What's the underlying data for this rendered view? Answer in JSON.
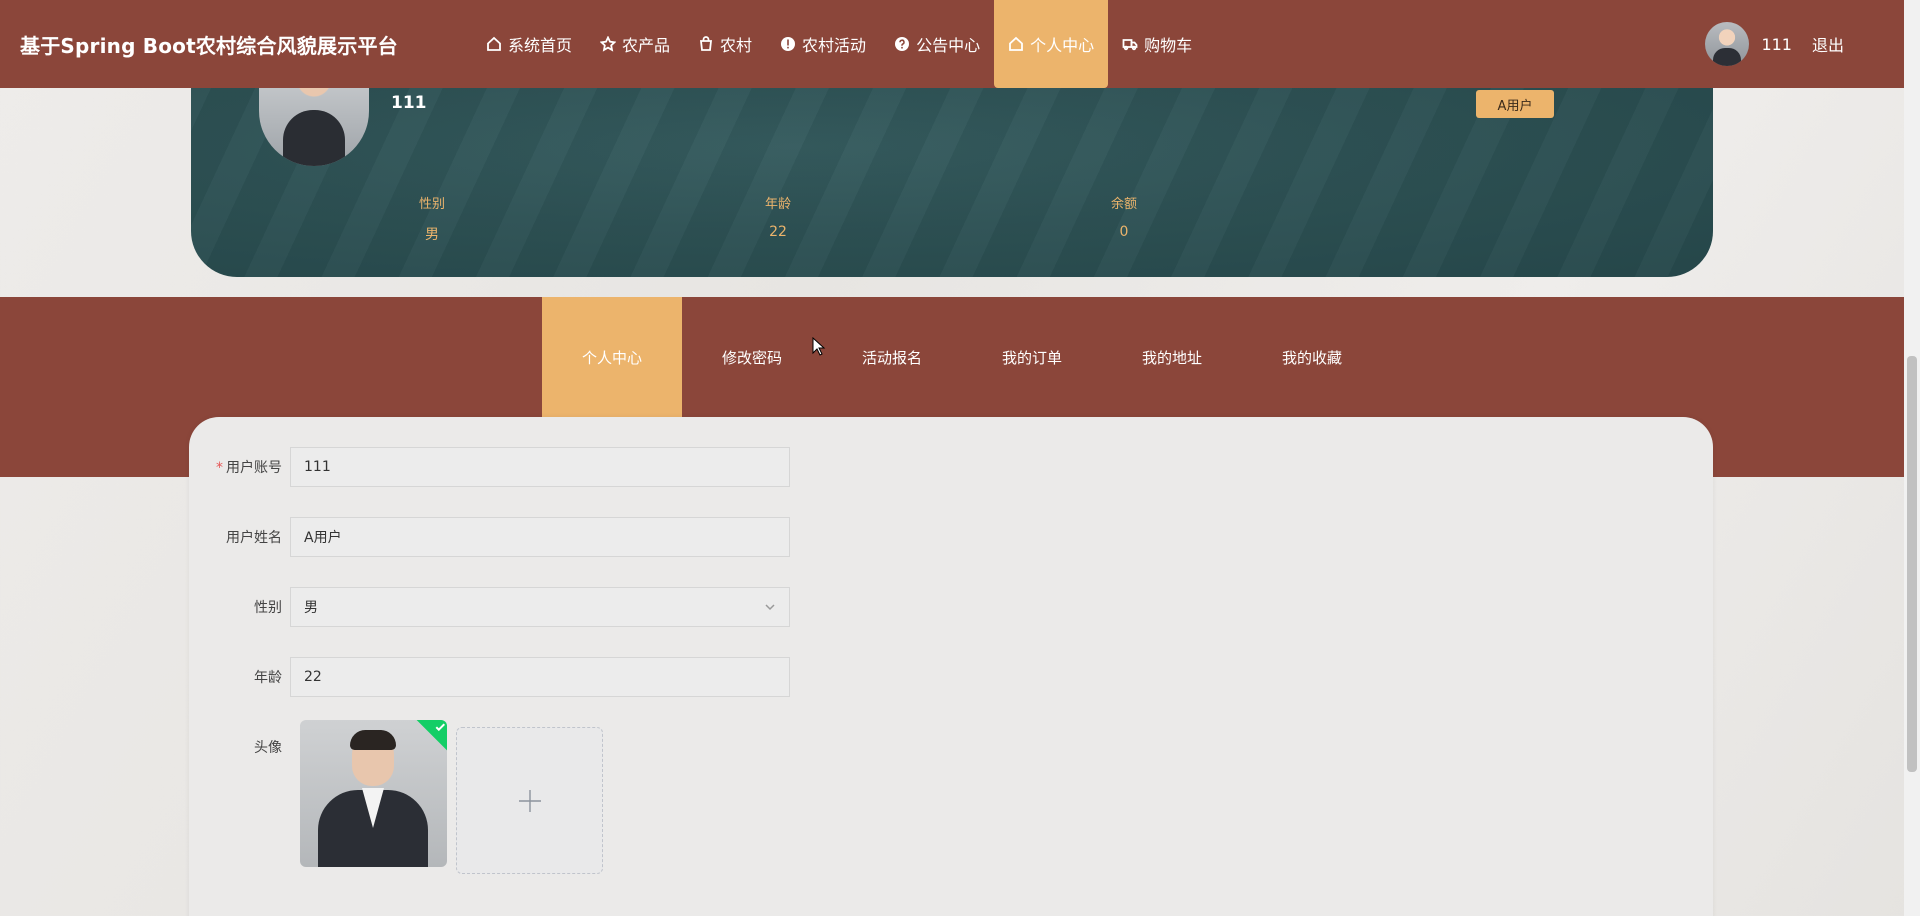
{
  "brand": "基于Spring Boot农村综合风貌展示平台",
  "nav": [
    {
      "label": "系统首页",
      "icon": "home-icon"
    },
    {
      "label": "农产品",
      "icon": "star-icon"
    },
    {
      "label": "农村",
      "icon": "bag-icon"
    },
    {
      "label": "农村活动",
      "icon": "info-icon"
    },
    {
      "label": "公告中心",
      "icon": "help-icon"
    },
    {
      "label": "个人中心",
      "icon": "home-icon",
      "active": true
    },
    {
      "label": "购物车",
      "icon": "truck-icon"
    }
  ],
  "user": {
    "name": "111",
    "logout": "退出"
  },
  "profile": {
    "name": "111",
    "role": "A用户",
    "stats": [
      {
        "label": "性别",
        "value": "男"
      },
      {
        "label": "年龄",
        "value": "22"
      },
      {
        "label": "余额",
        "value": "0"
      }
    ]
  },
  "tabs": [
    {
      "label": "个人中心",
      "active": true
    },
    {
      "label": "修改密码"
    },
    {
      "label": "活动报名"
    },
    {
      "label": "我的订单"
    },
    {
      "label": "我的地址"
    },
    {
      "label": "我的收藏"
    }
  ],
  "form": {
    "account": {
      "label": "用户账号",
      "value": "111",
      "required": "*"
    },
    "realname": {
      "label": "用户姓名",
      "value": "A用户"
    },
    "gender": {
      "label": "性别",
      "value": "男"
    },
    "age": {
      "label": "年龄",
      "value": "22"
    },
    "avatar": {
      "label": "头像"
    }
  },
  "colors": {
    "primary": "#8b463a",
    "accent": "#ecb46c",
    "banner": "#2d5154",
    "success": "#13ce66"
  }
}
